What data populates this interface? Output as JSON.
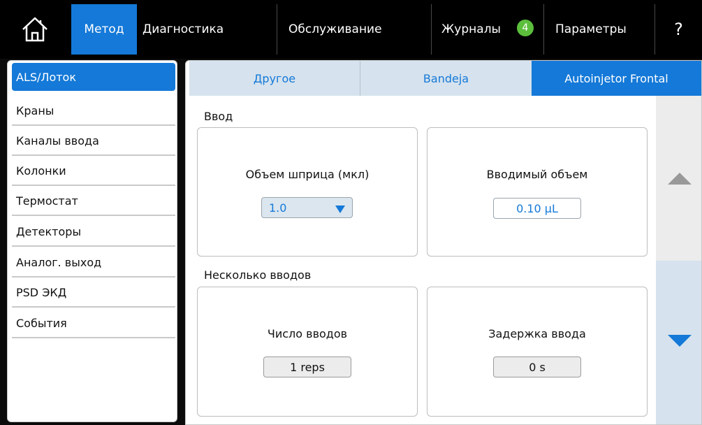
{
  "nav": {
    "home_icon": "home-icon",
    "items": [
      {
        "label": "Метод",
        "active": true
      },
      {
        "label": "Диагностика",
        "active": false
      },
      {
        "label": "Обслуживание",
        "active": false
      },
      {
        "label": "Журналы",
        "active": false,
        "badge": "4"
      },
      {
        "label": "Параметры",
        "active": false
      }
    ],
    "help_label": "?"
  },
  "sidebar": {
    "items": [
      {
        "label": "ALS/Лоток",
        "active": true
      },
      {
        "label": "Краны"
      },
      {
        "label": "Каналы ввода"
      },
      {
        "label": "Колонки"
      },
      {
        "label": "Термостат"
      },
      {
        "label": "Детекторы"
      },
      {
        "label": "Аналог. выход"
      },
      {
        "label": "PSD ЭКД"
      },
      {
        "label": "События"
      }
    ]
  },
  "tabs": [
    {
      "label": "Другое",
      "active": false
    },
    {
      "label": "Bandeja",
      "active": false
    },
    {
      "label": "Autoinjetor Frontal",
      "active": true
    }
  ],
  "injection": {
    "section_title": "Ввод",
    "syringe": {
      "label": "Объем шприца (мкл)",
      "value": "1.0"
    },
    "volume": {
      "label": "Вводимый объем",
      "value": "0.10 µL"
    }
  },
  "multi": {
    "section_title": "Несколько вводов",
    "count": {
      "label": "Число вводов",
      "value": "1 reps"
    },
    "delay": {
      "label": "Задержка ввода",
      "value": "0 s"
    }
  },
  "scroll": {
    "up_icon": "triangle-up-icon",
    "down_icon": "triangle-down-icon"
  },
  "colors": {
    "accent": "#1479d8",
    "badge": "#5cbf3c",
    "tab_bg": "#d6e2ed"
  }
}
